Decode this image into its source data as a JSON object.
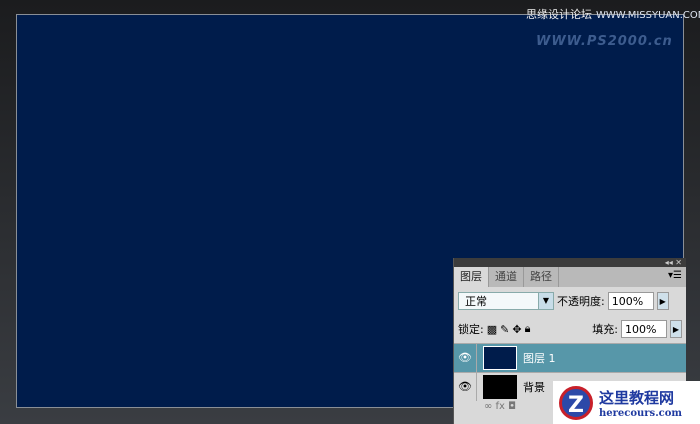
{
  "watermark_top": {
    "line1": "思缘设计论坛",
    "url1": "WWW.MISSYUAN.COM",
    "url2": "WWW.PS2000.cn"
  },
  "panel": {
    "collapse_label": "◂◂ ✕",
    "tabs": [
      "图层",
      "通道",
      "路径"
    ],
    "blend_mode": "正常",
    "opacity_label": "不透明度:",
    "opacity": "100%",
    "lock_label": "锁定:",
    "fill_label": "填充:",
    "fill": "100%",
    "layers": [
      {
        "name": "图层 1",
        "color": "#001c4b",
        "active": true
      },
      {
        "name": "背景",
        "color": "#000000",
        "active": false
      }
    ],
    "footer": "∞  fx  ◘"
  },
  "logo": {
    "mark": "Z",
    "title": "这里教程网",
    "url": "herecours.com"
  }
}
